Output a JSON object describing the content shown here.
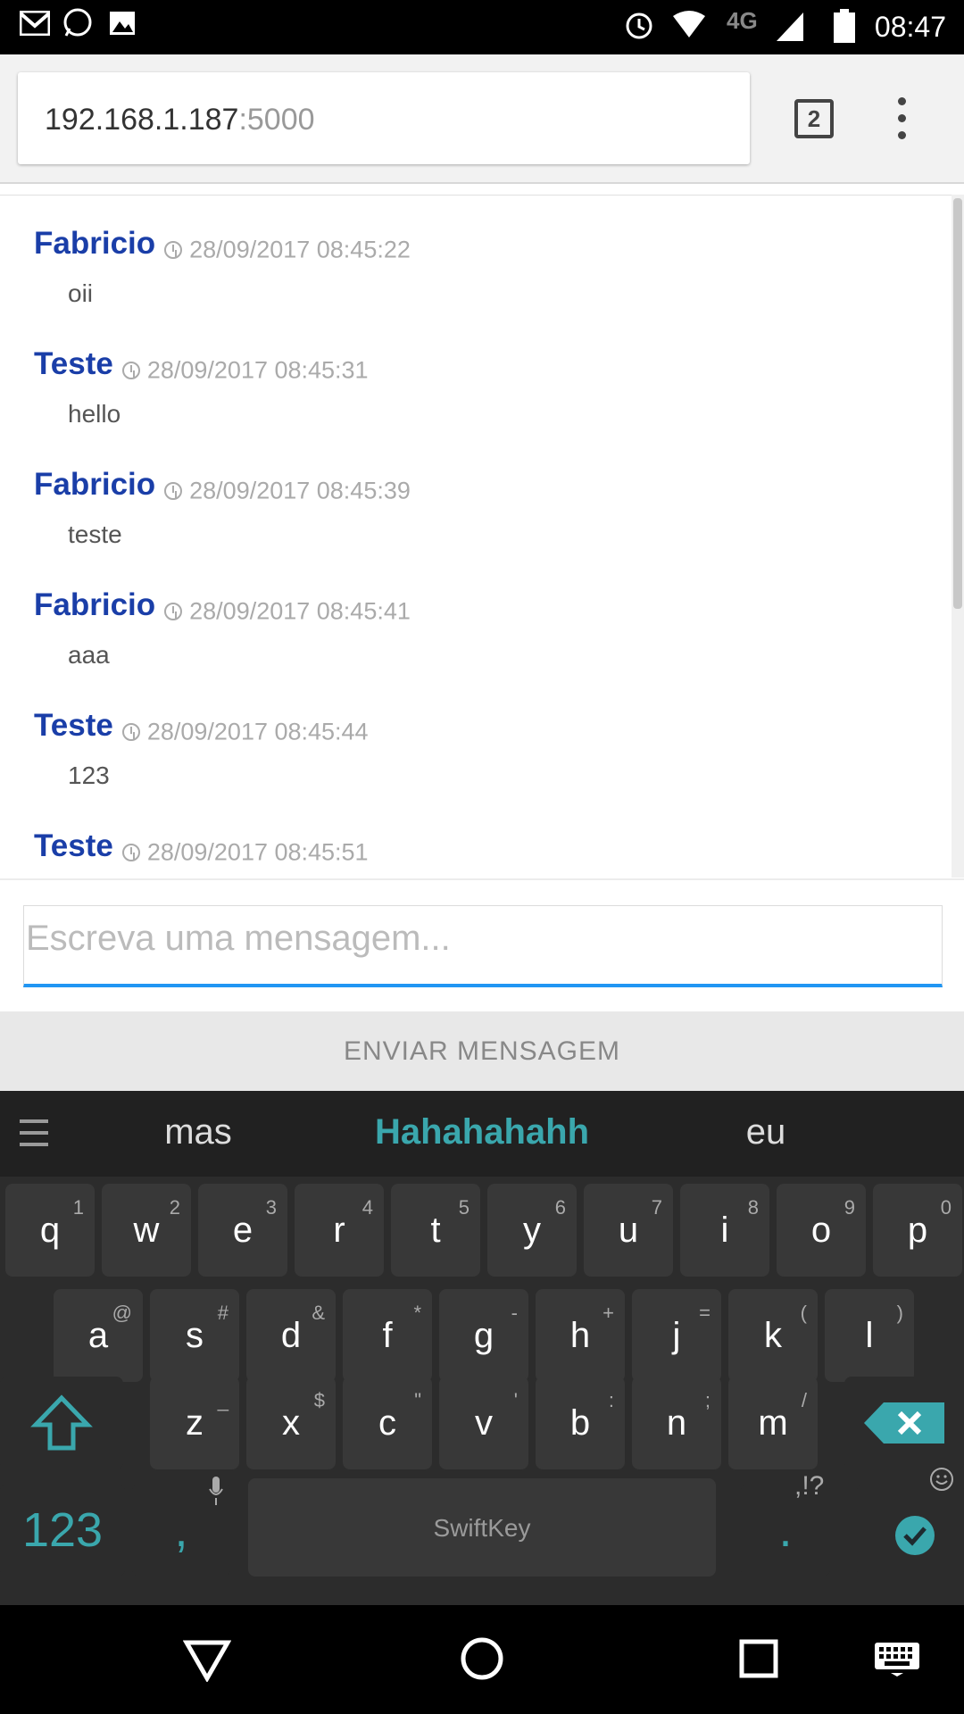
{
  "status_bar": {
    "network": "4G",
    "time": "08:47"
  },
  "browser": {
    "url_host": "192.168.1.187",
    "url_port": ":5000",
    "tab_count": "2"
  },
  "messages": [
    {
      "author": "Fabricio",
      "timestamp": "28/09/2017 08:45:22",
      "text": "oii"
    },
    {
      "author": "Teste",
      "timestamp": "28/09/2017 08:45:31",
      "text": "hello"
    },
    {
      "author": "Fabricio",
      "timestamp": "28/09/2017 08:45:39",
      "text": "teste"
    },
    {
      "author": "Fabricio",
      "timestamp": "28/09/2017 08:45:41",
      "text": "aaa"
    },
    {
      "author": "Teste",
      "timestamp": "28/09/2017 08:45:44",
      "text": "123"
    },
    {
      "author": "Teste",
      "timestamp": "28/09/2017 08:45:51",
      "text": ""
    }
  ],
  "composer": {
    "placeholder": "Escreva uma mensagem...",
    "send_label": "ENVIAR MENSAGEM"
  },
  "keyboard": {
    "suggestions": [
      "mas",
      "Hahahahahh",
      "eu"
    ],
    "row1": [
      [
        "q",
        "1"
      ],
      [
        "w",
        "2"
      ],
      [
        "e",
        "3"
      ],
      [
        "r",
        "4"
      ],
      [
        "t",
        "5"
      ],
      [
        "y",
        "6"
      ],
      [
        "u",
        "7"
      ],
      [
        "i",
        "8"
      ],
      [
        "o",
        "9"
      ],
      [
        "p",
        "0"
      ]
    ],
    "row2": [
      [
        "a",
        "@"
      ],
      [
        "s",
        "#"
      ],
      [
        "d",
        "&"
      ],
      [
        "f",
        "*"
      ],
      [
        "g",
        "-"
      ],
      [
        "h",
        "+"
      ],
      [
        "j",
        "="
      ],
      [
        "k",
        "("
      ],
      [
        "l",
        ")"
      ]
    ],
    "row3": [
      [
        "z",
        "_"
      ],
      [
        "x",
        "$"
      ],
      [
        "c",
        "\""
      ],
      [
        "v",
        "'"
      ],
      [
        "b",
        ":"
      ],
      [
        "n",
        ";"
      ],
      [
        "m",
        "/"
      ]
    ],
    "numbers_key": "123",
    "comma_key": ",",
    "period_key": ".",
    "punct_hint": ",!?",
    "space_brand": "SwiftKey"
  },
  "colors": {
    "author": "#1a3ea8",
    "accent_input": "#2196f3",
    "keyboard_accent": "#3aa7ad"
  }
}
